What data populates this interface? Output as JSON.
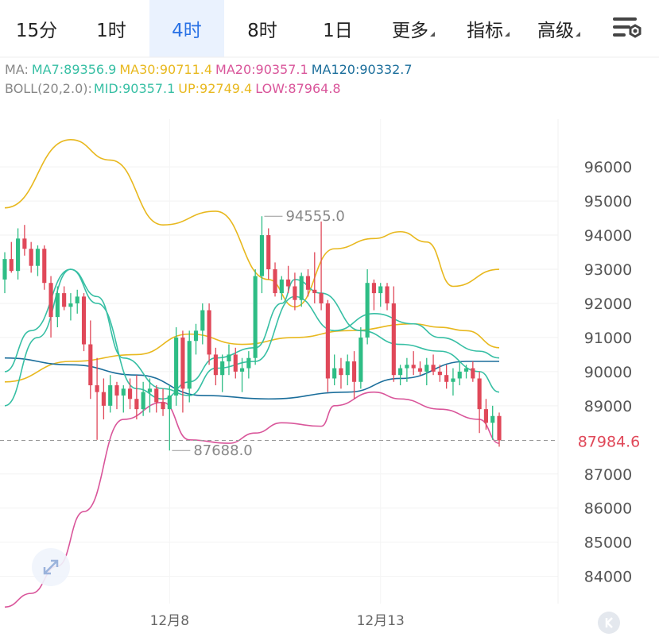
{
  "tabs": [
    {
      "label": "15分",
      "active": false
    },
    {
      "label": "1时",
      "active": false
    },
    {
      "label": "4时",
      "active": true
    },
    {
      "label": "8时",
      "active": false
    },
    {
      "label": "1日",
      "active": false
    }
  ],
  "menus": [
    {
      "label": "更多"
    },
    {
      "label": "指标"
    },
    {
      "label": "高级"
    }
  ],
  "indicators": {
    "ma": {
      "prefix": "MA:",
      "ma7": "MA7:89356.9",
      "ma30": "MA30:90711.4",
      "ma20": "MA20:90357.1",
      "ma120": "MA120:90332.7"
    },
    "boll": {
      "prefix": "BOLL(20,2.0):",
      "mid": "MID:90357.1",
      "up": "UP:92749.4",
      "low": "LOW:87964.8"
    }
  },
  "colors": {
    "up": "#2ebd85",
    "down": "#e04859",
    "ma7": "#37bfa4",
    "ma30": "#e8b81e",
    "ma20": "#d9559a",
    "ma120": "#1b6e9b",
    "accent": "#2a72e5",
    "price_tag": "#e04859"
  },
  "chart_data": {
    "type": "candlestick",
    "ylim": [
      83200,
      97400
    ],
    "y_ticks": [
      "96000",
      "95000",
      "94000",
      "93000",
      "92000",
      "91000",
      "90000",
      "89000",
      "87000",
      "86000",
      "85000",
      "84000"
    ],
    "x_labels": [
      "12月8",
      "12月13"
    ],
    "current_price": "87984.6",
    "high_label": "94555.0",
    "low_label": "87688.0",
    "candles": [
      [
        92700,
        93500,
        92300,
        93300
      ],
      [
        93300,
        93800,
        92900,
        92950
      ],
      [
        92950,
        94200,
        92700,
        93900
      ],
      [
        93900,
        94300,
        93400,
        93600
      ],
      [
        93600,
        93800,
        92900,
        93100
      ],
      [
        93100,
        93700,
        92800,
        93600
      ],
      [
        93600,
        93700,
        92400,
        92600
      ],
      [
        92600,
        92800,
        91000,
        91600
      ],
      [
        91600,
        92500,
        91300,
        92300
      ],
      [
        92300,
        92500,
        91800,
        91900
      ],
      [
        91900,
        92300,
        91500,
        92000
      ],
      [
        92000,
        92400,
        91700,
        92200
      ],
      [
        92200,
        92300,
        90600,
        90800
      ],
      [
        90800,
        91500,
        89200,
        89600
      ],
      [
        89600,
        90400,
        88000,
        89400
      ],
      [
        89400,
        89800,
        88600,
        89000
      ],
      [
        89000,
        89900,
        88800,
        89600
      ],
      [
        89600,
        89700,
        88900,
        89300
      ],
      [
        89300,
        89600,
        88800,
        89500
      ],
      [
        89500,
        89800,
        88900,
        89200
      ],
      [
        89200,
        89900,
        88600,
        88900
      ],
      [
        88900,
        89700,
        88700,
        89400
      ],
      [
        89400,
        89800,
        88800,
        89500
      ],
      [
        89500,
        89600,
        88800,
        89100
      ],
      [
        89100,
        89500,
        88700,
        88900
      ],
      [
        88900,
        89600,
        87688,
        89300
      ],
      [
        89300,
        91300,
        89000,
        91000
      ],
      [
        91000,
        91200,
        88800,
        89500
      ],
      [
        89500,
        91200,
        89100,
        90900
      ],
      [
        90900,
        91400,
        90500,
        91200
      ],
      [
        91200,
        92000,
        90800,
        91800
      ],
      [
        91800,
        92000,
        90200,
        90500
      ],
      [
        90500,
        90700,
        89600,
        89900
      ],
      [
        89900,
        90500,
        89400,
        90300
      ],
      [
        90300,
        90800,
        89900,
        90500
      ],
      [
        90500,
        90700,
        89800,
        90000
      ],
      [
        90000,
        90400,
        89400,
        90100
      ],
      [
        90100,
        90600,
        89800,
        90400
      ],
      [
        90400,
        93000,
        90200,
        92800
      ],
      [
        92800,
        94555,
        92300,
        94000
      ],
      [
        94000,
        94200,
        92700,
        93000
      ],
      [
        93000,
        93200,
        92200,
        92300
      ],
      [
        92300,
        92800,
        92100,
        92700
      ],
      [
        92700,
        93100,
        92300,
        92500
      ],
      [
        92500,
        92900,
        91800,
        92100
      ],
      [
        92100,
        92900,
        91900,
        92800
      ],
      [
        92800,
        93000,
        92200,
        92400
      ],
      [
        92400,
        93500,
        92000,
        92300
      ],
      [
        92300,
        94400,
        91800,
        92000
      ],
      [
        92000,
        92100,
        89400,
        89800
      ],
      [
        89800,
        90500,
        89600,
        90100
      ],
      [
        90100,
        90400,
        89500,
        89900
      ],
      [
        89900,
        90500,
        89600,
        90300
      ],
      [
        90300,
        90600,
        89200,
        89700
      ],
      [
        89700,
        91300,
        89500,
        91000
      ],
      [
        91000,
        93000,
        90800,
        92600
      ],
      [
        92600,
        92700,
        91800,
        92300
      ],
      [
        92300,
        92600,
        91900,
        92500
      ],
      [
        92500,
        92600,
        91800,
        92000
      ],
      [
        92000,
        92500,
        89700,
        89900
      ],
      [
        89900,
        90200,
        89600,
        90100
      ],
      [
        90100,
        90400,
        89700,
        90200
      ],
      [
        90200,
        90600,
        89900,
        90100
      ],
      [
        90100,
        90300,
        89900,
        90000
      ],
      [
        90000,
        90400,
        89600,
        90200
      ],
      [
        90200,
        90500,
        89900,
        90000
      ],
      [
        90000,
        90200,
        89700,
        89900
      ],
      [
        89900,
        90200,
        89500,
        89700
      ],
      [
        89700,
        90100,
        89300,
        89800
      ],
      [
        89800,
        90300,
        89600,
        90000
      ],
      [
        90000,
        90200,
        89800,
        90100
      ],
      [
        90100,
        90300,
        89700,
        89800
      ],
      [
        89800,
        90000,
        88200,
        88900
      ],
      [
        88900,
        89200,
        88300,
        88500
      ],
      [
        88500,
        89000,
        88000,
        88700
      ],
      [
        88700,
        88800,
        87800,
        87985
      ]
    ],
    "series": [
      {
        "key": "boll_up",
        "x": [
          0,
          10,
          16,
          24,
          32,
          40,
          44,
          50,
          56,
          60,
          64,
          68,
          75
        ],
        "y": [
          94800,
          96800,
          96200,
          94300,
          94700,
          92700,
          91900,
          93600,
          93900,
          94100,
          93800,
          92500,
          93000
        ]
      },
      {
        "key": "ma30",
        "x": [
          0,
          10,
          20,
          28,
          36,
          44,
          52,
          62,
          66,
          70,
          75
        ],
        "y": [
          89700,
          90300,
          90500,
          91100,
          90800,
          91000,
          91200,
          91400,
          91300,
          91200,
          90700
        ]
      },
      {
        "key": "ma120",
        "x": [
          0,
          10,
          20,
          30,
          40,
          52,
          60,
          70,
          75
        ],
        "y": [
          90400,
          90200,
          89900,
          89300,
          89200,
          89400,
          89800,
          90300,
          90300
        ]
      },
      {
        "key": "ma7",
        "x": [
          0,
          5,
          10,
          14,
          20,
          24,
          28,
          32,
          38,
          42,
          44,
          48,
          54,
          60,
          66,
          72,
          75
        ],
        "y": [
          89000,
          91000,
          93000,
          92000,
          89500,
          89200,
          89700,
          90400,
          90700,
          92000,
          92700,
          92300,
          91200,
          90800,
          90600,
          90000,
          89400
        ]
      },
      {
        "key": "ma20",
        "x": [
          0,
          4,
          10,
          14,
          18,
          24,
          28,
          32,
          38,
          44,
          50,
          56,
          62,
          66,
          72,
          75
        ],
        "y": [
          90000,
          91200,
          93000,
          92200,
          90400,
          89500,
          89300,
          90100,
          90300,
          92200,
          91200,
          91700,
          91400,
          91000,
          90600,
          90400
        ]
      },
      {
        "key": "boll_low",
        "x": [
          0,
          4,
          8,
          12,
          18,
          24,
          28,
          34,
          38,
          42,
          48,
          50,
          56,
          60,
          66,
          72,
          75
        ],
        "y": [
          83100,
          83500,
          84300,
          85900,
          88600,
          89100,
          88000,
          87900,
          88200,
          88500,
          88400,
          89000,
          89400,
          89200,
          88900,
          88600,
          87900
        ]
      }
    ]
  }
}
